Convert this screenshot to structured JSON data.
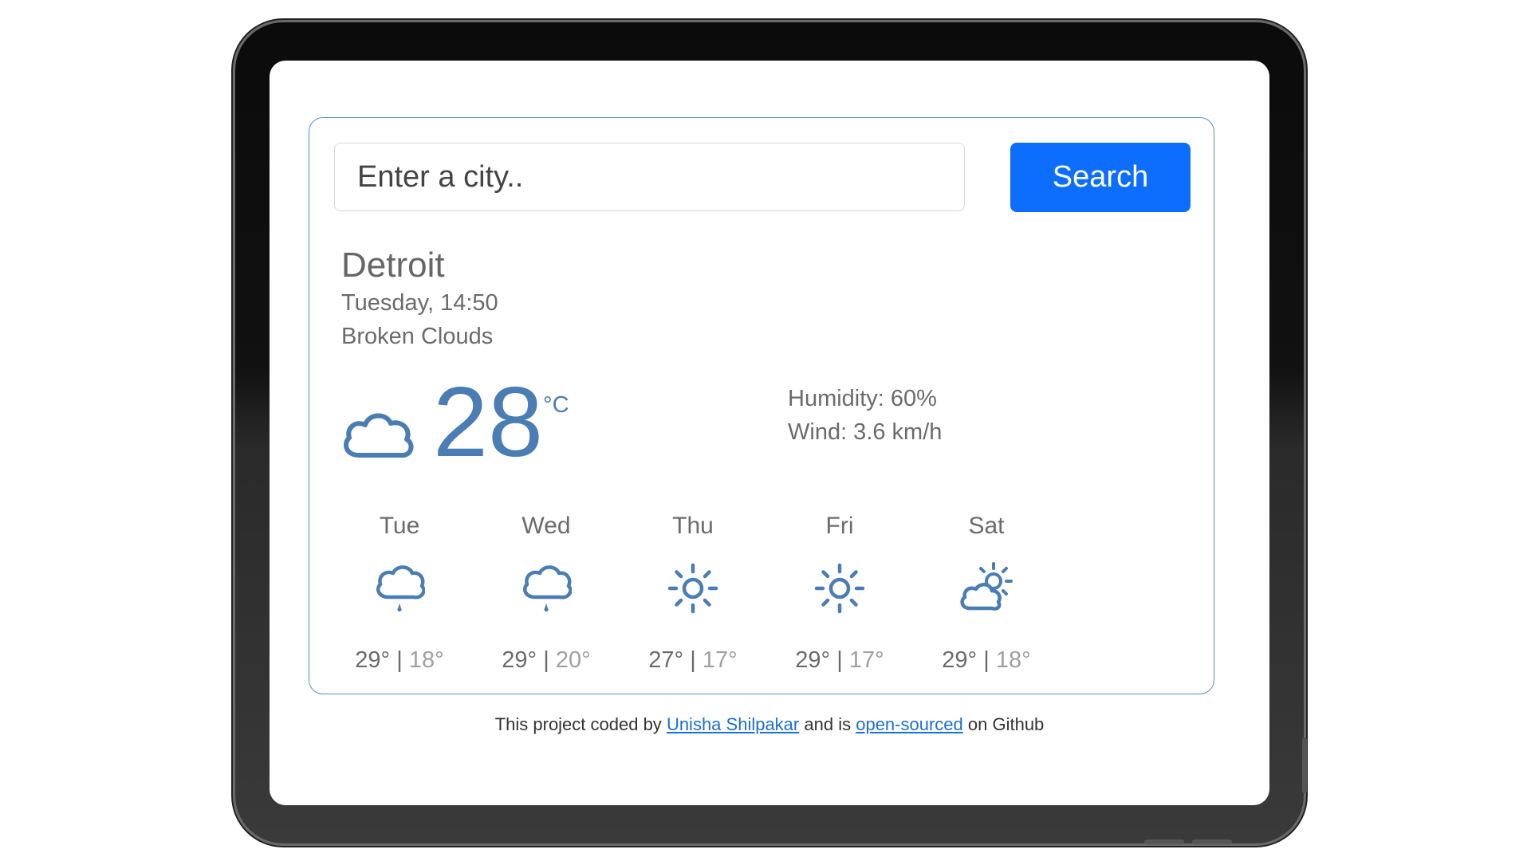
{
  "search": {
    "placeholder": "Enter a city..",
    "button_label": "Search"
  },
  "current": {
    "city": "Detroit",
    "datetime": "Tuesday, 14:50",
    "description": "Broken Clouds",
    "temperature": "28",
    "unit": "°C",
    "humidity": "Humidity: 60%",
    "wind": "Wind: 3.6 km/h",
    "icon": "broken-clouds-icon"
  },
  "forecast": [
    {
      "day": "Tue",
      "max": "29°",
      "min": "18°",
      "icon": "rain-cloud-icon"
    },
    {
      "day": "Wed",
      "max": "29°",
      "min": "20°",
      "icon": "rain-cloud-icon"
    },
    {
      "day": "Thu",
      "max": "27°",
      "min": "17°",
      "icon": "sun-icon"
    },
    {
      "day": "Fri",
      "max": "29°",
      "min": "17°",
      "icon": "sun-icon"
    },
    {
      "day": "Sat",
      "max": "29°",
      "min": "18°",
      "icon": "partly-cloudy-icon"
    }
  ],
  "footer": {
    "prefix": "This project coded by",
    "author": "Unisha Shilpakar",
    "middle": "and is",
    "link": "open-sourced",
    "suffix": "on Github"
  },
  "colors": {
    "accent": "#0d6efd",
    "temperature": "#4a7db4",
    "card_border": "#5a8fc4"
  }
}
